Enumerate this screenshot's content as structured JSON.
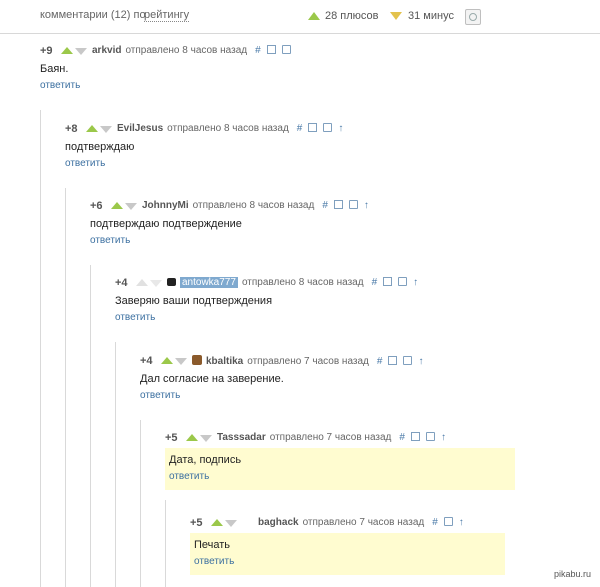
{
  "header": {
    "comments_label": "комментарии (12) по",
    "sort_label": "рейтингу",
    "plus_label": "28 плюсов",
    "minus_label": "31 минус",
    "settings_icon": "settings-icon"
  },
  "comments": [
    {
      "score": "+9",
      "user": "arkvid",
      "posted": "отправлено 8 часов назад",
      "text": "Баян.",
      "reply": "ответить"
    },
    {
      "score": "+8",
      "user": "EvilJesus",
      "posted": "отправлено 8 часов назад",
      "text": "подтверждаю",
      "reply": "ответить"
    },
    {
      "score": "+6",
      "user": "JohnnyMi",
      "posted": "отправлено 8 часов назад",
      "text": "подтверждаю подтверждение",
      "reply": "ответить"
    },
    {
      "score": "+4",
      "user": "antowka777",
      "posted": "отправлено 8 часов назад",
      "text": "Заверяю ваши подтверждения",
      "reply": "ответить"
    },
    {
      "score": "+4",
      "user": "kbaltika",
      "posted": "отправлено 7 часов назад",
      "text": "Дал согласие на заверение.",
      "reply": "ответить"
    },
    {
      "score": "+5",
      "user": "Tasssadar",
      "posted": "отправлено 7 часов назад",
      "text": "Дата, подпись",
      "reply": "ответить"
    },
    {
      "score": "+5",
      "user": "baghack",
      "posted": "отправлено 7 часов назад",
      "text": "Печать",
      "reply": "ответить"
    }
  ],
  "icons": {
    "link": "#",
    "up": "↑"
  },
  "footer": {
    "watermark": "pikabu.ru"
  },
  "colors": {
    "plus": "#9bc84a",
    "minus": "#e3c24c",
    "link": "#3b6fa0",
    "highlight": "#fffcd0"
  }
}
